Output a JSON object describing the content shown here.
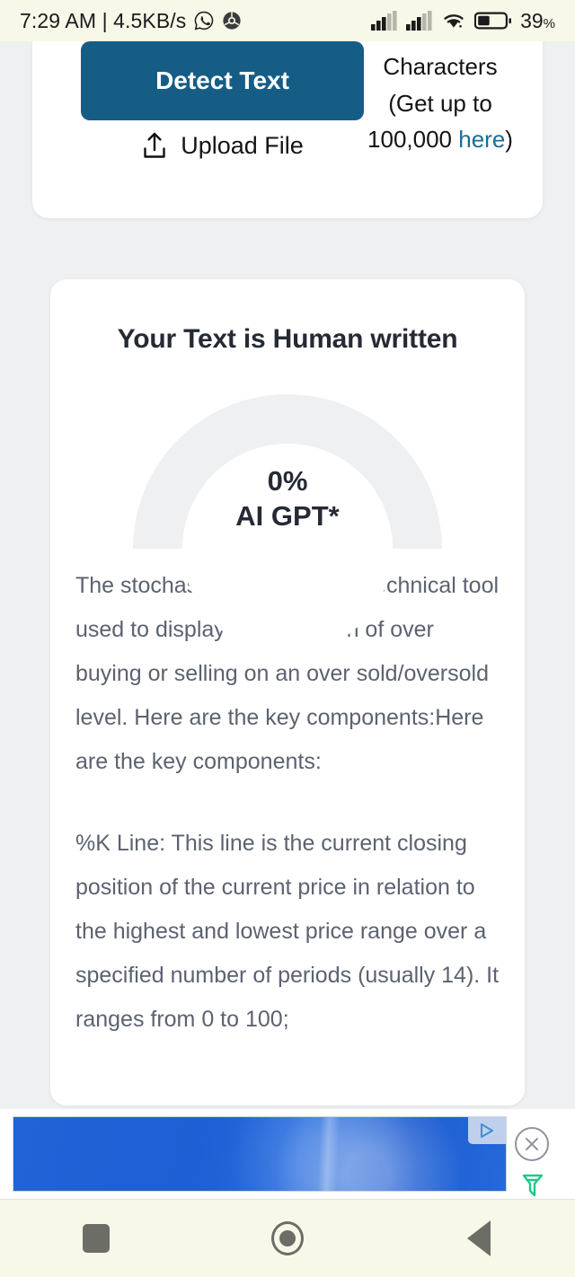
{
  "status_bar": {
    "clock": "7:29 AM | 4.5KB/s",
    "whatsapp_icon": "whatsapp-icon",
    "chrome_icon": "chrome-icon",
    "signal_icon_1": "signal-bars-icon",
    "signal_icon_2": "signal-bars-icon",
    "wifi_icon": "wifi-icon",
    "battery_icon": "battery-icon",
    "battery_percent": "39",
    "battery_percent_symbol": "%"
  },
  "detect_card": {
    "detect_button_label": "Detect\nText",
    "detect_button_color": "#165d86",
    "upload_icon": "upload-icon",
    "upload_label": "Upload File",
    "characters_note_prefix": "Characters (Get up to 100,000 ",
    "characters_note_link": "here",
    "characters_note_suffix": ")",
    "link_color": "#1b6e95"
  },
  "result_card": {
    "title": "Your Text is Human written",
    "gauge": {
      "percent_label": "0%",
      "model_label": "AI GPT*",
      "value": 0,
      "track_color": "#eff0f1"
    },
    "paragraphs": [
      "The stochastic Oscillator is a technical tool used to display the condition of over buying or selling on an over sold/oversold level. Here are the key components:Here are the key components:",
      "%K Line: This line is the current closing position of the current price in relation to the highest and lowest price range over a specified number of periods (usually 14). It ranges from 0 to 100;"
    ]
  },
  "ad": {
    "adchoices_icon": "adchoices-icon",
    "close_icon": "close-icon",
    "brand_icon": "freestar-funnel-icon"
  },
  "nav_bar": {
    "recents_icon": "recents-square-icon",
    "home_icon": "home-circle-icon",
    "back_icon": "back-triangle-icon"
  }
}
